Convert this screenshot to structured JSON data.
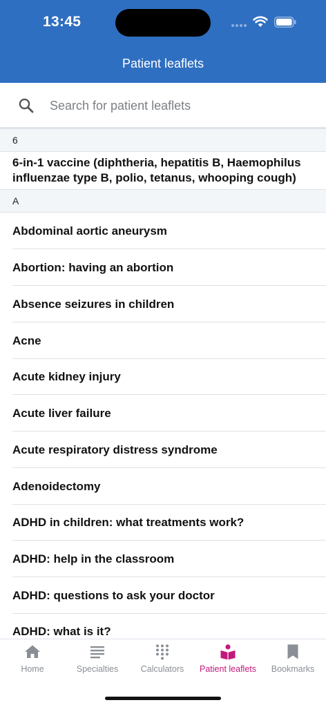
{
  "status_bar": {
    "time": "13:45"
  },
  "header": {
    "title": "Patient leaflets"
  },
  "search": {
    "placeholder": "Search for patient leaflets"
  },
  "sections": [
    {
      "letter": "6",
      "items": [
        "6-in-1 vaccine (diphtheria, hepatitis B, Haemophilus influenzae type B, polio, tetanus, whooping cough)"
      ]
    },
    {
      "letter": "A",
      "items": [
        "Abdominal aortic aneurysm",
        "Abortion: having an abortion",
        "Absence seizures in children",
        "Acne",
        "Acute kidney injury",
        "Acute liver failure",
        "Acute respiratory distress syndrome",
        "Adenoidectomy",
        "ADHD in children: what treatments work?",
        "ADHD: help in the classroom",
        "ADHD: questions to ask your doctor",
        "ADHD: what is it?"
      ]
    }
  ],
  "tabs": [
    {
      "label": "Home",
      "icon": "home-icon",
      "active": false
    },
    {
      "label": "Specialties",
      "icon": "list-icon",
      "active": false
    },
    {
      "label": "Calculators",
      "icon": "keypad-icon",
      "active": false
    },
    {
      "label": "Patient leaflets",
      "icon": "book-icon",
      "active": true
    },
    {
      "label": "Bookmarks",
      "icon": "bookmark-icon",
      "active": false
    }
  ],
  "colors": {
    "header": "#2f6fc1",
    "active_tab": "#c2187c",
    "inactive_tab": "#8a8f96"
  }
}
